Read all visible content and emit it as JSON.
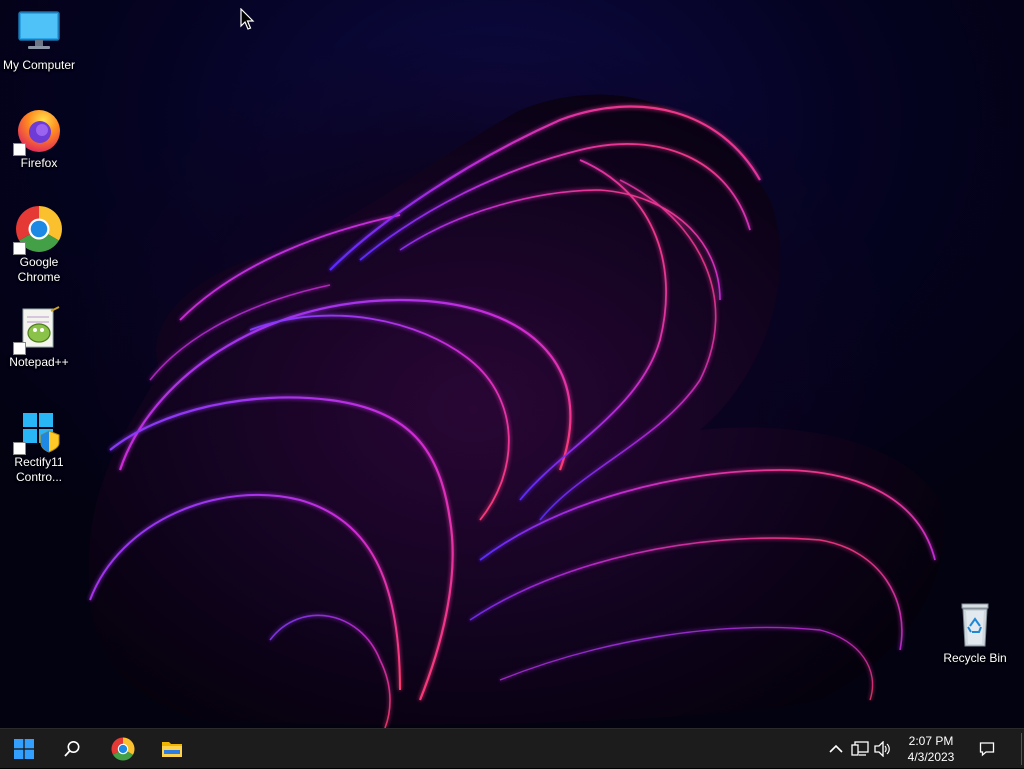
{
  "desktop": {
    "icons": [
      {
        "label": "My Computer",
        "icon": "monitor-icon"
      },
      {
        "label": "Firefox",
        "icon": "firefox-icon"
      },
      {
        "label": "Google Chrome",
        "icon": "chrome-icon"
      },
      {
        "label": "Notepad++",
        "icon": "notepad-plus-plus-icon"
      },
      {
        "label": "Rectify11 Contro...",
        "icon": "rectify11-icon"
      },
      {
        "label": "Recycle Bin",
        "icon": "recycle-bin-icon"
      }
    ]
  },
  "taskbar": {
    "pinned": [
      {
        "icon": "windows-start-icon"
      },
      {
        "icon": "search-icon"
      },
      {
        "icon": "chrome-icon"
      },
      {
        "icon": "file-explorer-icon"
      }
    ],
    "tray": {
      "icons": [
        "chevron-up-icon",
        "network-icon",
        "volume-icon"
      ],
      "time": "2:07 PM",
      "date": "4/3/2023",
      "notification_icon": "notification-icon"
    }
  },
  "colors": {
    "taskbar_bg": "#1c1c1c",
    "wallpaper_glow": "#c026d3",
    "wallpaper_edge": "#ff3b7a",
    "windows_blue": "#1e90ff"
  }
}
